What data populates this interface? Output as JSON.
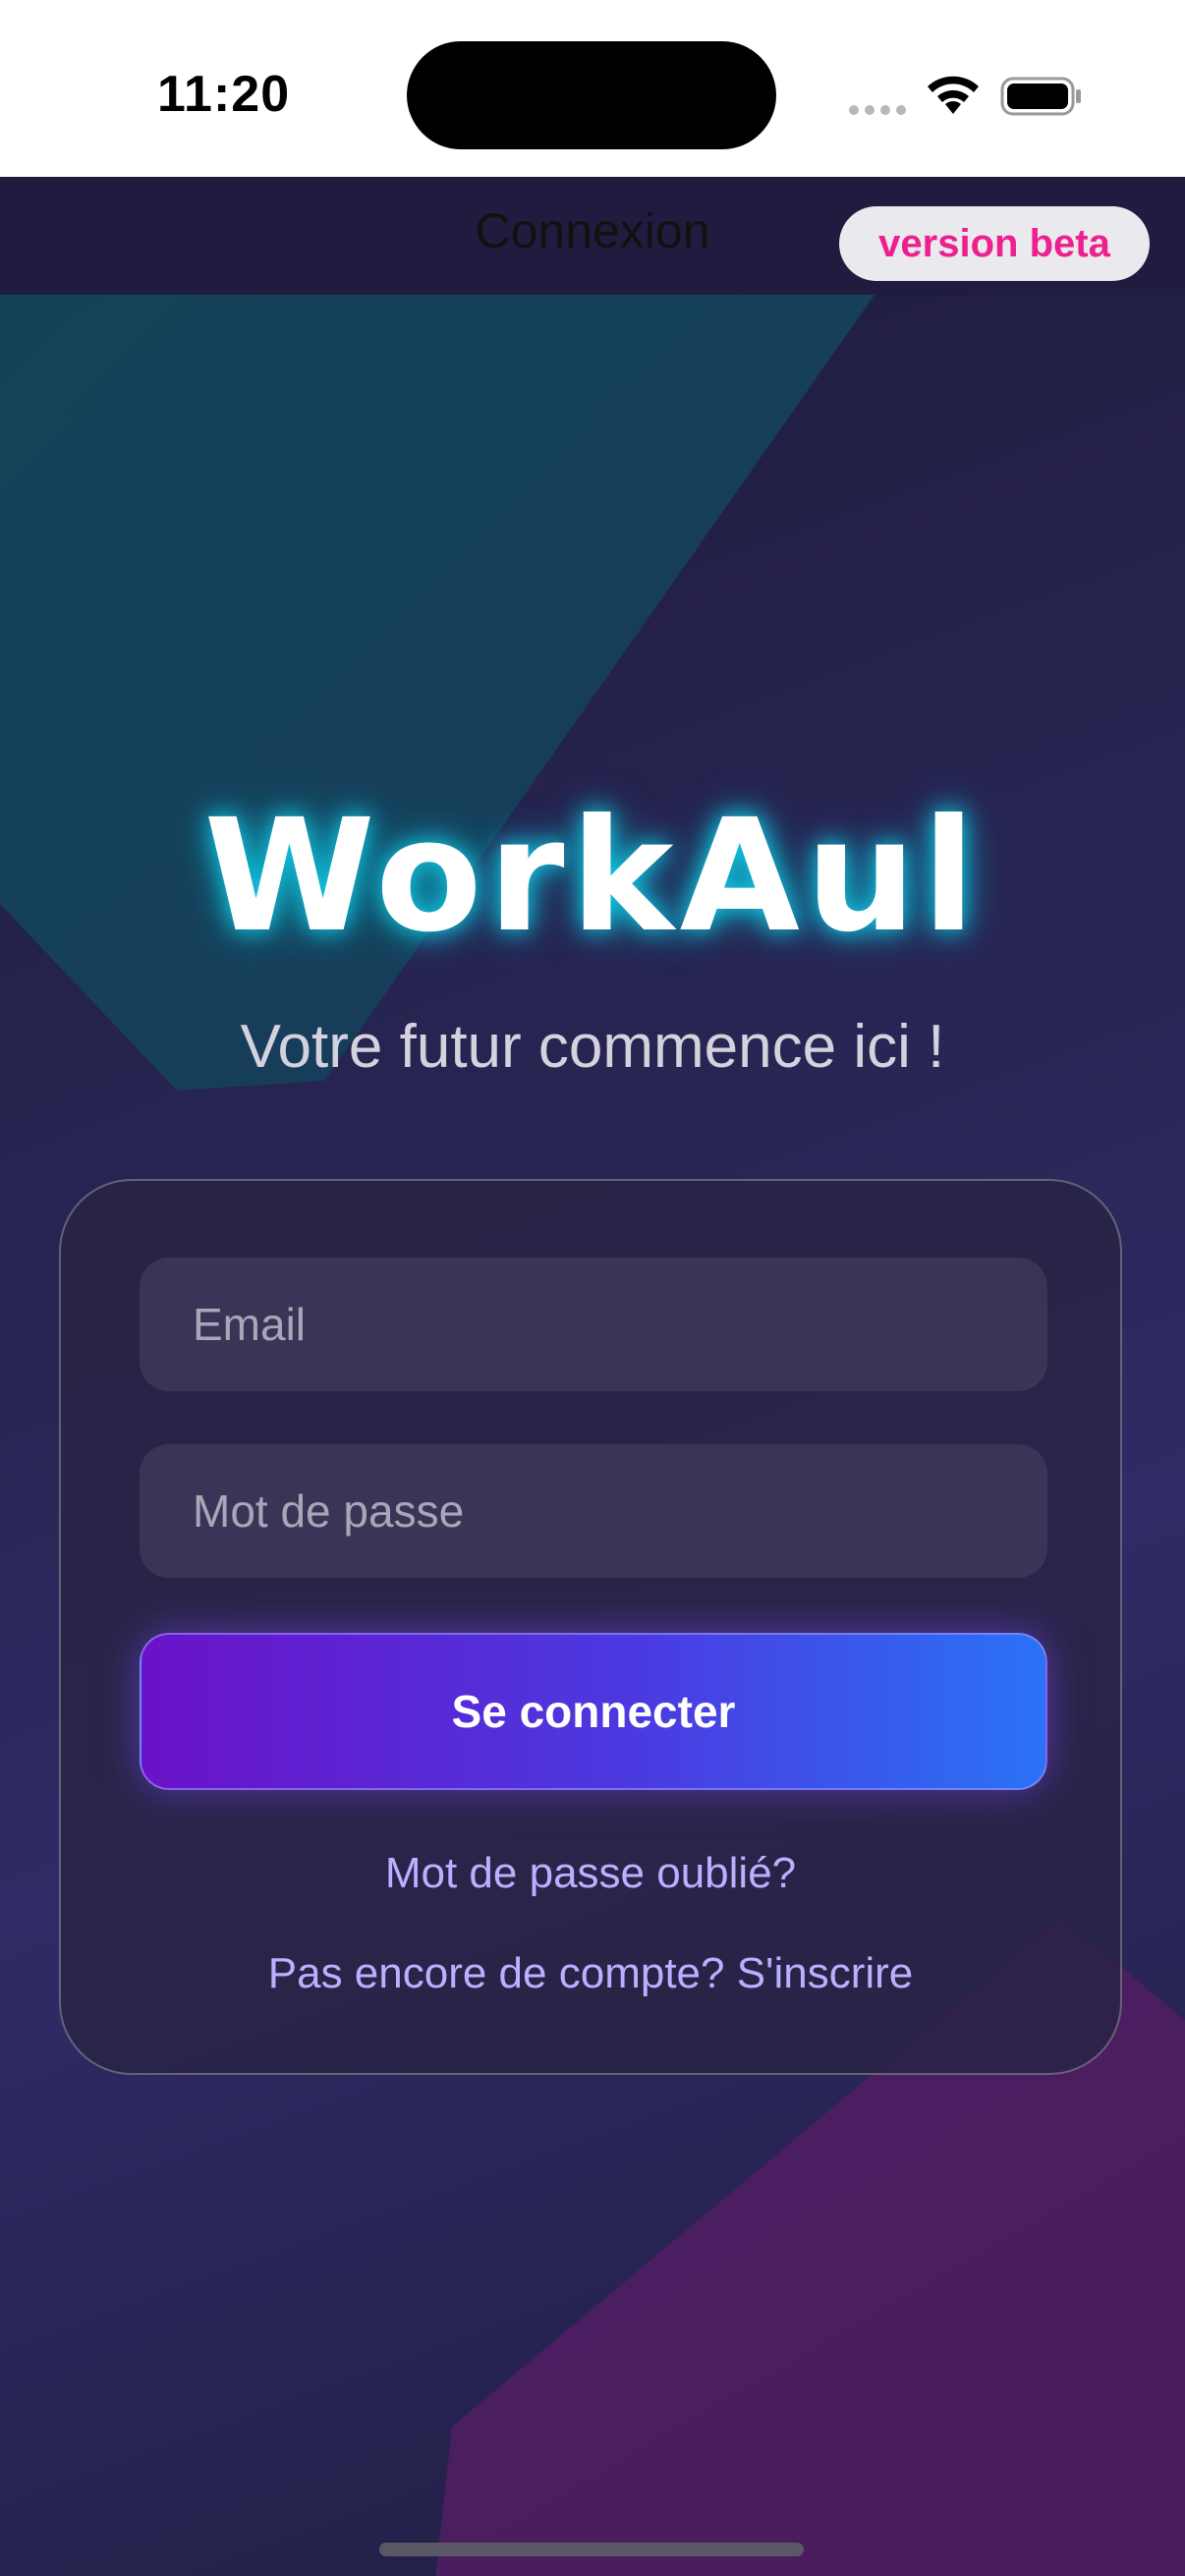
{
  "status_bar": {
    "time": "11:20"
  },
  "nav": {
    "title": "Connexion",
    "beta_badge": "version beta"
  },
  "hero": {
    "logo": "WorkAul",
    "tagline": "Votre futur commence ici !"
  },
  "login_form": {
    "email_placeholder": "Email",
    "password_placeholder": "Mot de passe",
    "submit_label": "Se connecter",
    "forgot_password_link": "Mot de passe oublié?",
    "signup_link": "Pas encore de compte? S'inscrire"
  },
  "colors": {
    "accent_pink": "#ee1f8e",
    "glow_teal": "#12c6e0",
    "button_start": "#6a12c8",
    "button_end": "#2a72f5",
    "link": "#bab0ff"
  }
}
